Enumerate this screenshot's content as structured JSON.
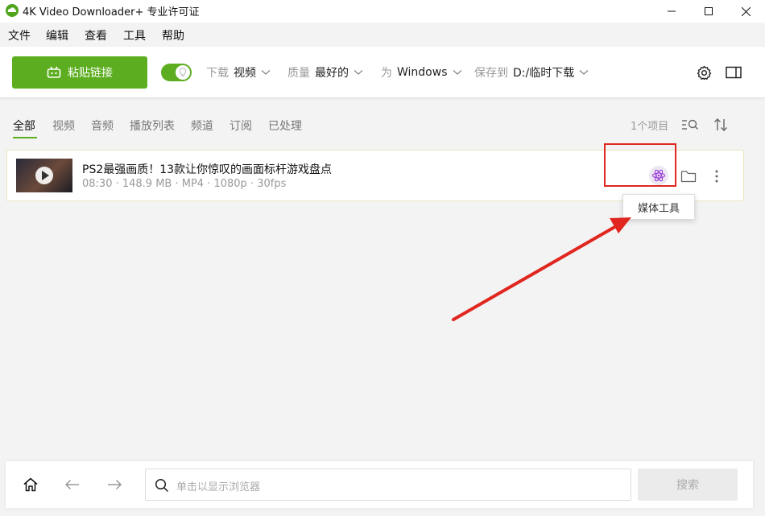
{
  "window": {
    "title": "4K Video Downloader+ 专业许可证"
  },
  "menu": [
    "文件",
    "编辑",
    "查看",
    "工具",
    "帮助"
  ],
  "toolbar": {
    "paste_label": "粘贴链接",
    "download_label": "下载",
    "download_value": "视频",
    "quality_label": "质量",
    "quality_value": "最好的",
    "for_label": "为",
    "for_value": "Windows",
    "save_label": "保存到",
    "save_value": "D:/临时下载"
  },
  "tabs": [
    "全部",
    "视频",
    "音频",
    "播放列表",
    "频道",
    "订阅",
    "已处理"
  ],
  "item_count": "1个项目",
  "item": {
    "title": "PS2最强画质！13款让你惊叹的画面标杆游戏盘点",
    "meta": "08:30 · 148.9 MB · MP4 · 1080p · 30fps"
  },
  "tooltip": "媒体工具",
  "bottom": {
    "search_placeholder": "单击以显示浏览器",
    "search_button": "搜索"
  },
  "colors": {
    "accent": "#5cad1f",
    "annotation": "#e0261f",
    "media_tool": "#9b3fd6"
  },
  "icons": [
    "app-logo-icon",
    "minimize-icon",
    "maximize-icon",
    "close-icon",
    "paste-link-icon",
    "smart-mode-bulb-icon",
    "chevron-down-icon",
    "settings-gear-icon",
    "sidebar-panel-icon",
    "filter-search-icon",
    "sort-icon",
    "play-icon",
    "media-tools-atom-icon",
    "folder-icon",
    "more-vertical-icon",
    "home-icon",
    "back-arrow-icon",
    "forward-arrow-icon",
    "search-icon"
  ]
}
